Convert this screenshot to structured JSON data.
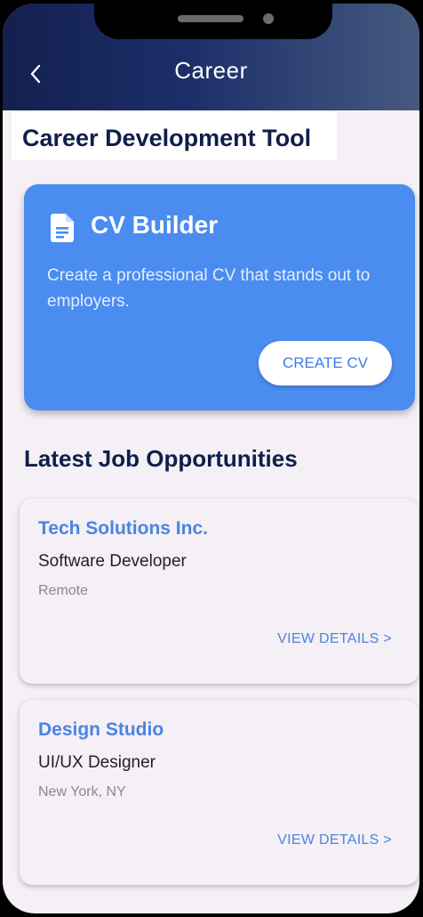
{
  "header": {
    "title": "Career"
  },
  "section": {
    "title": "Career Development Tool"
  },
  "cv_card": {
    "title": "CV Builder",
    "description": "Create a professional CV that stands out to employers.",
    "button_label": "CREATE CV",
    "icon": "document-icon"
  },
  "jobs": {
    "title": "Latest Job Opportunities",
    "items": [
      {
        "company": "Tech Solutions Inc.",
        "role": "Software Developer",
        "location": "Remote",
        "action": "VIEW DETAILS >"
      },
      {
        "company": "Design Studio",
        "role": "UI/UX Designer",
        "location": "New York, NY",
        "action": "VIEW DETAILS >"
      }
    ]
  },
  "colors": {
    "header_start": "#13204f",
    "header_end": "#46597f",
    "accent_blue": "#4a8cf0",
    "link_blue": "#4a85e0",
    "heading_navy": "#0f1f4b",
    "background": "#f5f0f5"
  }
}
